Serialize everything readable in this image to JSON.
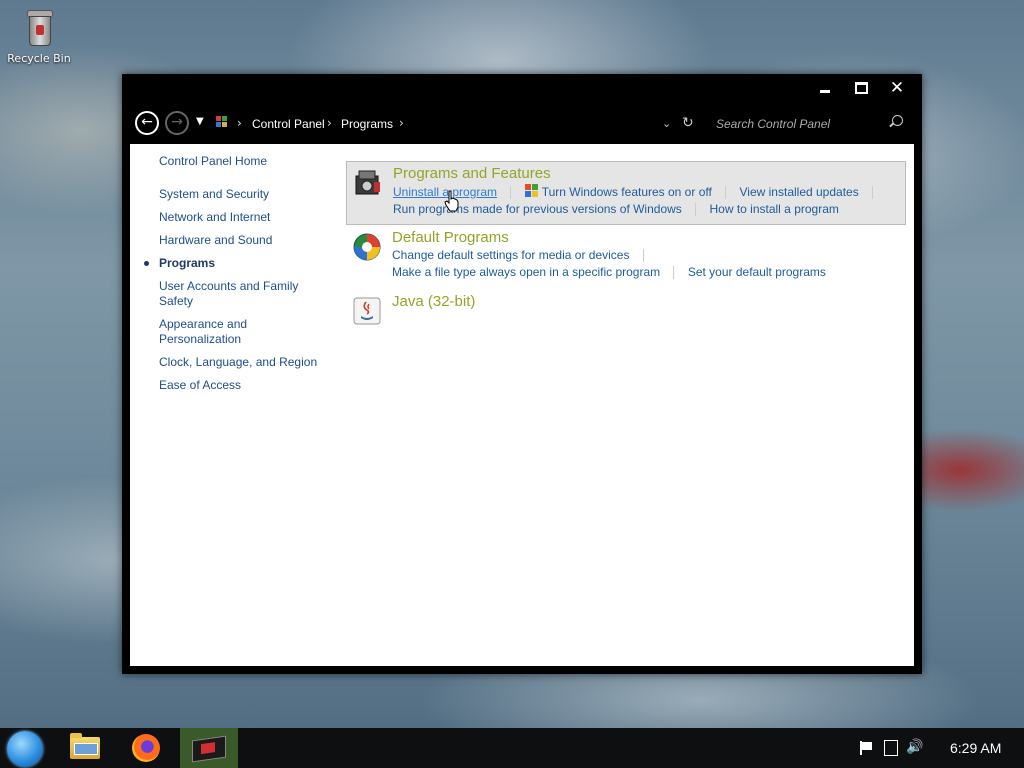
{
  "desktop": {
    "icons": [
      {
        "label": "Recycle Bin"
      }
    ]
  },
  "window": {
    "controls": {
      "minimize": "minimize",
      "maximize": "maximize",
      "close": "✕"
    },
    "address": {
      "breadcrumbs": [
        "Control Panel",
        "Programs"
      ],
      "search_placeholder": "Search Control Panel"
    },
    "left_nav": {
      "home": "Control Panel Home",
      "items": [
        {
          "label": "System and Security",
          "current": false
        },
        {
          "label": "Network and Internet",
          "current": false
        },
        {
          "label": "Hardware and Sound",
          "current": false
        },
        {
          "label": "Programs",
          "current": true
        },
        {
          "label": "User Accounts and Family Safety",
          "current": false
        },
        {
          "label": "Appearance and Personalization",
          "current": false
        },
        {
          "label": "Clock, Language, and Region",
          "current": false
        },
        {
          "label": "Ease of Access",
          "current": false
        }
      ]
    },
    "categories": {
      "programs_features": {
        "title": "Programs and Features",
        "links_row1": [
          "Uninstall a program",
          "Turn Windows features on or off",
          "View installed updates"
        ],
        "links_row2": [
          "Run programs made for previous versions of Windows",
          "How to install a program"
        ]
      },
      "default_programs": {
        "title": "Default Programs",
        "links_row1": [
          "Change default settings for media or devices"
        ],
        "links_row2": [
          "Make a file type always open in a specific program",
          "Set your default programs"
        ]
      },
      "java": {
        "title": "Java (32-bit)"
      }
    }
  },
  "taskbar": {
    "clock": "6:29 AM"
  },
  "colors": {
    "category_title": "#93a526",
    "link": "#1e5c9a",
    "taskbar_active": "#3b5a2a"
  }
}
